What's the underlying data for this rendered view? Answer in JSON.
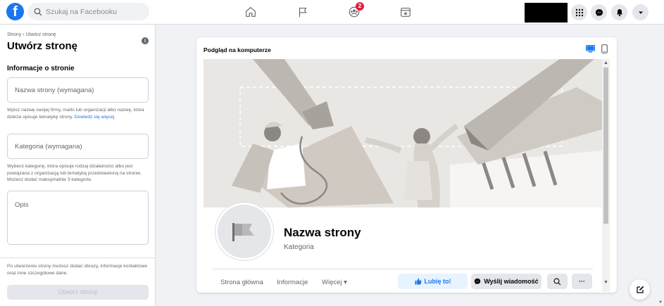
{
  "topbar": {
    "logo_letter": "f",
    "search_placeholder": "Szukaj na Facebooku",
    "nav_icons": [
      "home-icon",
      "flag-icon",
      "groups-icon",
      "gaming-icon"
    ],
    "groups_badge": "2",
    "right_icons": [
      "menu-grid-icon",
      "messenger-icon",
      "notifications-icon",
      "account-caret-icon"
    ]
  },
  "sidebar": {
    "breadcrumb": "Strony › Utwórz stronę",
    "title": "Utwórz stronę",
    "info_glyph": "i",
    "section_title": "Informacje o stronie",
    "name_placeholder": "Nazwa strony (wymagana)",
    "name_help": "Wpisz nazwę swojej firmy, marki lub organizacji albo nazwę, która dobrze opisuje tematykę strony.",
    "name_help_link": "Dowiedz się więcej",
    "category_placeholder": "Kategoria (wymagana)",
    "category_help": "Wybierz kategorię, która opisuje rodzaj działalności albo jest powiązana z organizacją lub tematyką przedstawioną na stronie. Możesz dodać maksymalnie 3 kategorie.",
    "description_placeholder": "Opis",
    "footer_note": "Po utworzeniu strony możesz dodać obrazy, informacje kontaktowe oraz inne szczegółowe dane.",
    "create_button": "Utwórz stronę"
  },
  "preview": {
    "title": "Podgląd na komputerze",
    "page_name": "Nazwa strony",
    "page_category": "Kategoria",
    "tabs": [
      "Strona główna",
      "Informacje",
      "Więcej ▾"
    ],
    "like_button": "Lubię to!",
    "message_button": "Wyślij wiadomość",
    "more_button": "···",
    "scroll_up": "▲",
    "scroll_down": "▼"
  },
  "colors": {
    "brand": "#1877f2",
    "badge": "#e41e3f"
  }
}
